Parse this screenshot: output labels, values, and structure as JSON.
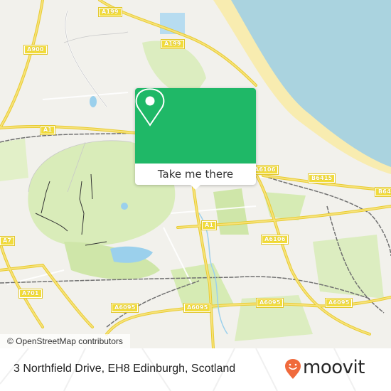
{
  "map": {
    "attribution": "© OpenStreetMap contributors",
    "colors": {
      "sea": "#aad3df",
      "beach": "#f8ecb0",
      "park": "#d6ebb4",
      "land": "#f2f1ec",
      "road_major": "#f2dc3a",
      "railway": "#707070",
      "water": "#9bd0ec"
    },
    "road_labels": [
      {
        "id": "a199-north",
        "text": "A199"
      },
      {
        "id": "a199-east",
        "text": "A199"
      },
      {
        "id": "a900",
        "text": "A900"
      },
      {
        "id": "a1-west",
        "text": "A1"
      },
      {
        "id": "a6106-north",
        "text": "A6106"
      },
      {
        "id": "b6415",
        "text": "B6415"
      },
      {
        "id": "b6415-east",
        "text": "B64"
      },
      {
        "id": "a1-center",
        "text": "A1"
      },
      {
        "id": "a6106",
        "text": "A6106"
      },
      {
        "id": "a7",
        "text": "A7"
      },
      {
        "id": "a701",
        "text": "A701"
      },
      {
        "id": "a6095-1",
        "text": "A6095"
      },
      {
        "id": "a6095-2",
        "text": "A6095"
      },
      {
        "id": "a6095-3",
        "text": "A6095"
      },
      {
        "id": "a6095-4",
        "text": "A6095"
      },
      {
        "id": "a6095-5",
        "text": "A6095"
      }
    ]
  },
  "popup": {
    "button_label": "Take me there",
    "accent": "#1fb867",
    "icon": "map-pin-icon"
  },
  "footer": {
    "address": "3 Northfield Drive, EH8 Edinburgh, Scotland",
    "brand": "moovit",
    "brand_color": "#f06a3c"
  }
}
